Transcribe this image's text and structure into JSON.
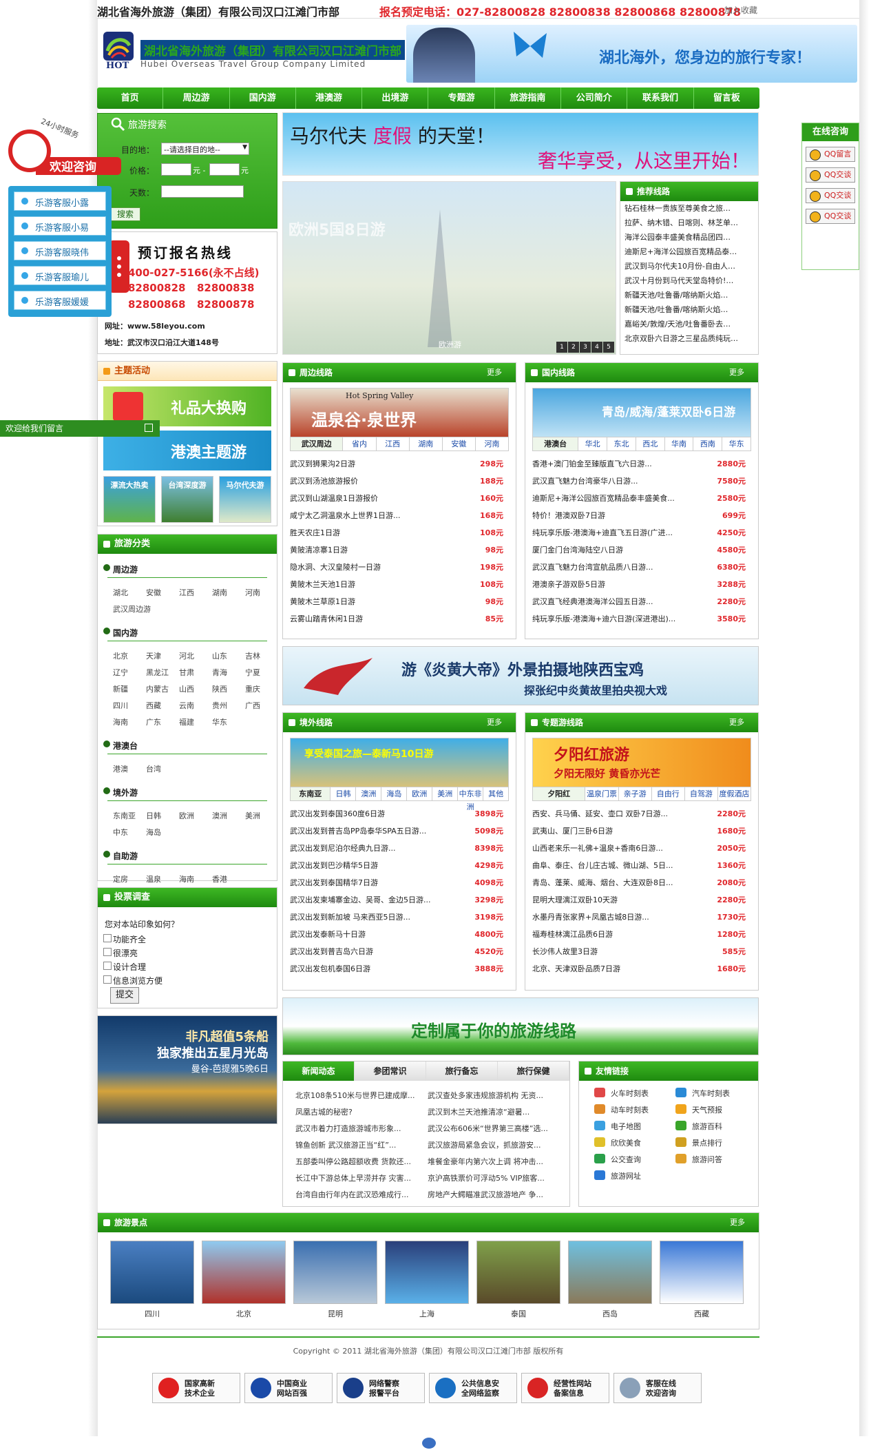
{
  "topbar": {
    "company": "湖北省海外旅游（集团）有限公司汉口江滩门市部",
    "hotline": "报名预定电话：027-82800828  82800838  82800868  82800878",
    "favorite": "加入收藏"
  },
  "brand": {
    "logo_text": "HOT",
    "name_cn": "湖北省海外旅游（集团）有限公司汉口江滩门市部",
    "name_en": "Hubei Overseas Travel Group Company Limited",
    "slogan": "湖北海外，您身边的旅行专家！"
  },
  "nav": [
    "首页",
    "周边游",
    "国内游",
    "港澳游",
    "出境游",
    "专题游",
    "旅游指南",
    "公司简介",
    "联系我们",
    "留言板"
  ],
  "search": {
    "title": "旅游搜索",
    "dest_label": "目的地：",
    "dest_value": "--请选择目的地--",
    "price_label": "价格：",
    "price_sep": "元 -",
    "price_unit": "元",
    "days_label": "天数：",
    "button": "搜索"
  },
  "hotline": {
    "title": "预订报名热线",
    "phone_main": "400-027-5166(永不占线)",
    "phones": [
      "82800828",
      "82800838",
      "82800868",
      "82800878"
    ],
    "web": "网址：www.58leyou.com",
    "address": "地址：武汉市汉口沿江大道148号"
  },
  "float_left": {
    "service": "24小时服务",
    "welcome": "欢迎咨询",
    "items": [
      "乐游客服小露",
      "乐游客服小易",
      "乐游客服晓伟",
      "乐游客服瑜儿",
      "乐游客服媛媛"
    ]
  },
  "msgbar": "欢迎给我们留言",
  "float_right": {
    "title": "在线咨询",
    "btns": [
      "QQ留言",
      "QQ交谈",
      "QQ交谈",
      "QQ交谈"
    ]
  },
  "theme": {
    "title": "主题活动",
    "gift": "礼品大换购",
    "hkmacau": "港澳主题游",
    "small": [
      "漂流大热卖",
      "台湾深度游",
      "马尔代夫游"
    ]
  },
  "category": {
    "title": "旅游分类",
    "groups": [
      {
        "name": "周边游",
        "items": [
          "湖北",
          "安徽",
          "江西",
          "湖南",
          "河南",
          "武汉周边游"
        ]
      },
      {
        "name": "国内游",
        "items": [
          "北京",
          "天津",
          "河北",
          "山东",
          "吉林",
          "辽宁",
          "黑龙江",
          "甘肃",
          "青海",
          "宁夏",
          "新疆",
          "内蒙古",
          "山西",
          "陕西",
          "重庆",
          "四川",
          "西藏",
          "云南",
          "贵州",
          "广西",
          "海南",
          "广东",
          "福建",
          "华东"
        ]
      },
      {
        "name": "港澳台",
        "items": [
          "港澳",
          "台湾"
        ]
      },
      {
        "name": "境外游",
        "items": [
          "东南亚",
          "日韩",
          "欧洲",
          "澳洲",
          "美洲",
          "中东",
          "海岛"
        ]
      },
      {
        "name": "自助游",
        "items": [
          "定房",
          "温泉",
          "海南",
          "香港"
        ]
      }
    ]
  },
  "poll": {
    "title": "投票调查",
    "question": "您对本站印象如何？",
    "options": [
      "功能齐全",
      "很漂亮",
      "设计合理",
      "信息浏览方便"
    ],
    "submit": "提交"
  },
  "side_ad": {
    "l1": "非凡超值5条船",
    "l2": "独家推出五星月光岛",
    "l3": "曼谷-芭提雅5晚6日"
  },
  "hero": {
    "l1a": "马尔代夫",
    "l1b": "度假",
    "l1c": "的天堂！",
    "l2": "奢华享受，从这里开始！"
  },
  "slide": {
    "caption": "欧洲5国8日游",
    "label": "欧洲游",
    "pages": [
      "1",
      "2",
      "3",
      "4",
      "5"
    ]
  },
  "recommend": {
    "title": "推荐线路",
    "items": [
      "钻石桂林一贵族至尊美食之旅…",
      "拉萨、纳木错、日喀则、林芝单…",
      "海洋公园泰丰盛美食精品团四…",
      "迪斯尼+海洋公园旅百宽精品泰…",
      "武汉到马尔代夫10月份-自由人…",
      "武汉十月份到马代天堂岛特价!…",
      "新疆天池/吐鲁番/喀纳斯火焰…",
      "新疆天池/吐鲁番/喀纳斯火焰…",
      "嘉峪关/敦煌/天池/吐鲁番卧去…",
      "北京双卧六日游之三星品质纯玩…"
    ]
  },
  "box_near": {
    "title": "周边线路",
    "more": "更多",
    "banner_sub": "Hot Spring Valley",
    "banner": "温泉谷·泉世界",
    "tabs": [
      "武汉周边",
      "省内",
      "江西",
      "湖南",
      "安徽",
      "河南"
    ],
    "rows": [
      [
        "武汉到狮果沟2日游",
        "298元"
      ],
      [
        "武汉到汤池旅游报价",
        "188元"
      ],
      [
        "武汉到山湖温泉1日游报价",
        "160元"
      ],
      [
        "咸宁太乙洞温泉水上世界1日游...",
        "168元"
      ],
      [
        "胜天农庄1日游",
        "108元"
      ],
      [
        "黄陂清凉寨1日游",
        "98元"
      ],
      [
        "隐水洞、大汉皇陵村一日游",
        "198元"
      ],
      [
        "黄陂木兰天池1日游",
        "108元"
      ],
      [
        "黄陂木兰草原1日游",
        "98元"
      ],
      [
        "云雾山踏青休闲1日游",
        "85元"
      ]
    ]
  },
  "box_dom": {
    "title": "国内线路",
    "more": "更多",
    "banner": "青岛/威海/蓬莱双卧6日游",
    "tabs": [
      "港澳台",
      "华北",
      "东北",
      "西北",
      "华南",
      "西南",
      "华东"
    ],
    "rows": [
      [
        "香港+澳门铂金至臻版直飞六日游...",
        "2880元"
      ],
      [
        "武汉直飞魅力台湾豪华八日游...",
        "7580元"
      ],
      [
        "迪斯尼+海洋公园旅百宽精品泰丰盛美食...",
        "2580元"
      ],
      [
        "特价！港澳双卧7日游",
        "699元"
      ],
      [
        "纯玩享乐版-港澳海+迪直飞五日游(广进...",
        "4250元"
      ],
      [
        "厦门金门台湾海陆空八日游",
        "4580元"
      ],
      [
        "武汉直飞魅力台湾宣航品质八日游...",
        "6380元"
      ],
      [
        "港澳亲子游双卧5日游",
        "3288元"
      ],
      [
        "武汉直飞经典港澳海洋公园五日游...",
        "2280元"
      ],
      [
        "纯玩享乐版-港澳海+迪六日游(深进港出)...",
        "3580元"
      ]
    ]
  },
  "ad_mid": {
    "t1": "游《炎黄大帝》外景拍摄地陕西宝鸡",
    "t2": "探张纪中炎黄故里拍央视大戏"
  },
  "box_out": {
    "title": "境外线路",
    "more": "更多",
    "banner": "享受泰国之旅—泰新马10日游",
    "tabs": [
      "东南亚",
      "日韩",
      "澳洲",
      "海岛",
      "欧洲",
      "美洲",
      "中东非洲",
      "其他"
    ],
    "rows": [
      [
        "武汉出发到泰国360度6日游",
        "3898元"
      ],
      [
        "武汉出发到普吉岛PP岛泰华SPA五日游...",
        "5098元"
      ],
      [
        "武汉出发到尼泊尔经典九日游...",
        "8398元"
      ],
      [
        "武汉出发到巴沙精华5日游",
        "4298元"
      ],
      [
        "武汉出发到泰国精华7日游",
        "4098元"
      ],
      [
        "武汉出发柬埔寨金边、吴哥、金边5日游...",
        "3298元"
      ],
      [
        "武汉出发到新加坡 马来西亚5日游...",
        "3198元"
      ],
      [
        "武汉出发泰新马十日游",
        "4800元"
      ],
      [
        "武汉出发到普吉岛六日游",
        "4520元"
      ],
      [
        "武汉出发包机泰国6日游",
        "3888元"
      ]
    ]
  },
  "box_theme": {
    "title": "专题游线路",
    "more": "更多",
    "banner": "夕阳红旅游",
    "banner_sub": "夕阳无限好 黄昏亦光芒",
    "tabs": [
      "夕阳红",
      "温泉门票",
      "亲子游",
      "自由行",
      "自驾游",
      "度假酒店"
    ],
    "rows": [
      [
        "西安、兵马俑、延安、壶口 双卧7日游...",
        "2280元"
      ],
      [
        "武夷山、厦门三卧6日游",
        "1680元"
      ],
      [
        "山西老来乐一礼佛+温泉+香南6日游...",
        "2050元"
      ],
      [
        "曲阜、泰庄、台儿庄古城、微山湖、5日...",
        "1360元"
      ],
      [
        "青岛、蓬莱、威海、烟台、大连双卧8日...",
        "2080元"
      ],
      [
        "昆明大理漓江双卧10天游",
        "2280元"
      ],
      [
        "水墨丹青张家界+凤凰古城8日游...",
        "1730元"
      ],
      [
        "福寿桂林漓江品质6日游",
        "1280元"
      ],
      [
        "长沙伟人故里3日游",
        "585元"
      ],
      [
        "北京、天津双卧品质7日游",
        "1680元"
      ]
    ]
  },
  "ad_custom": "定制属于你的旅游线路",
  "news": {
    "tabs": [
      "新闻动态",
      "参团常识",
      "旅行备忘",
      "旅行保健"
    ],
    "left": [
      "北京108条510米与世界已建成摩...",
      "凤凰古城的秘密?",
      "武汉市着力打造旅游城市形象...",
      "锦鱼创新 武汉旅游正当“红”...",
      "五部委叫停公路超额收费 货款还...",
      "长江中下游总体上早涝并存 灾害...",
      "台湾自由行年内在武汉恐难成行..."
    ],
    "right": [
      "武汉查处多家违规旅游机构 无资...",
      "武汉到木兰天池推清凉“避暑...",
      "武汉公布606米“世界第三高楼”选...",
      "武汉旅游局紧急会议，抓旅游安...",
      "堆餐金豪年内第六次上调 将冲击...",
      "京沪高铁票价可浮动5% VIP旅客...",
      "房地产大鳄瞄准武汉旅游地产 争..."
    ]
  },
  "links": {
    "title": "友情链接",
    "items": [
      "火车时刻表",
      "汽车时刻表",
      "动车时刻表",
      "天气预报",
      "电子地图",
      "旅游百科",
      "欣欣美食",
      "景点排行",
      "公交查询",
      "旅游问答",
      "旅游网址"
    ]
  },
  "scenic": {
    "title": "旅游景点",
    "more": "更多",
    "items": [
      "四川",
      "北京",
      "昆明",
      "上海",
      "泰国",
      "西岛",
      "西藏"
    ]
  },
  "footer": {
    "copyright": "Copyright © 2011  湖北省海外旅游（集团）有限公司汉口江滩门市部  版权所有",
    "badges": [
      [
        "国家高新",
        "技术企业"
      ],
      [
        "中国商业",
        "网站百强"
      ],
      [
        "网络警察",
        "报警平台"
      ],
      [
        "公共信息安",
        "全网络监察"
      ],
      [
        "经营性网站",
        "备案信息"
      ],
      [
        "客服在线",
        "欢迎咨询"
      ]
    ]
  }
}
